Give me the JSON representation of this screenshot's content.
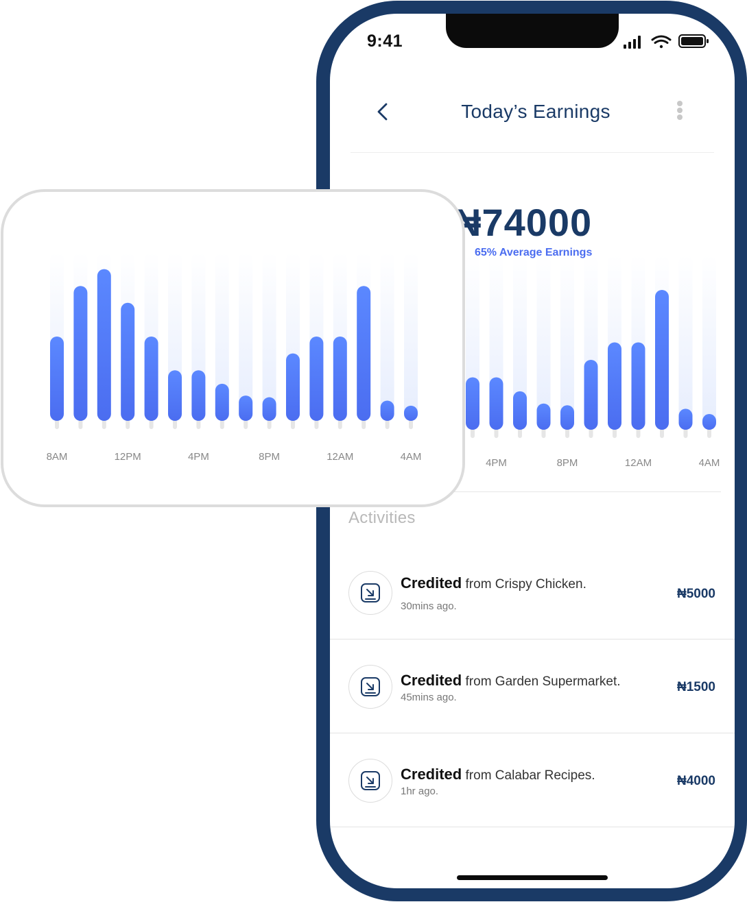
{
  "status_bar": {
    "time": "9:41"
  },
  "header": {
    "title": "Today’s Earnings",
    "back_icon": "chevron-left-icon",
    "menu_icon": "more-vertical-icon"
  },
  "earnings": {
    "amount": "₦74000",
    "subtitle": "65% Average Earnings"
  },
  "colors": {
    "brand": "#1a3a66",
    "accent": "#4b6df0",
    "bar_track": "#e6edfd"
  },
  "chart_data": {
    "type": "bar",
    "title": "",
    "xlabel": "",
    "ylabel": "",
    "x_tick_labels": [
      "8AM",
      "12PM",
      "4PM",
      "8PM",
      "12AM",
      "4AM"
    ],
    "values": [
      50,
      80,
      90,
      70,
      50,
      30,
      30,
      22,
      15,
      14,
      40,
      50,
      50,
      80,
      12,
      9
    ],
    "ylim": [
      0,
      100
    ],
    "grid": false
  },
  "activities": {
    "title": "Activities",
    "items": [
      {
        "label_bold": "Credited",
        "label_rest": " from Crispy Chicken.",
        "time": "30mins ago.",
        "amount": "₦5000"
      },
      {
        "label_bold": "Credited",
        "label_rest": " from Garden Supermarket.",
        "time": "45mins ago.",
        "amount": "₦1500"
      },
      {
        "label_bold": "Credited",
        "label_rest": " from Calabar Recipes.",
        "time": "1hr ago.",
        "amount": "₦4000"
      }
    ]
  }
}
